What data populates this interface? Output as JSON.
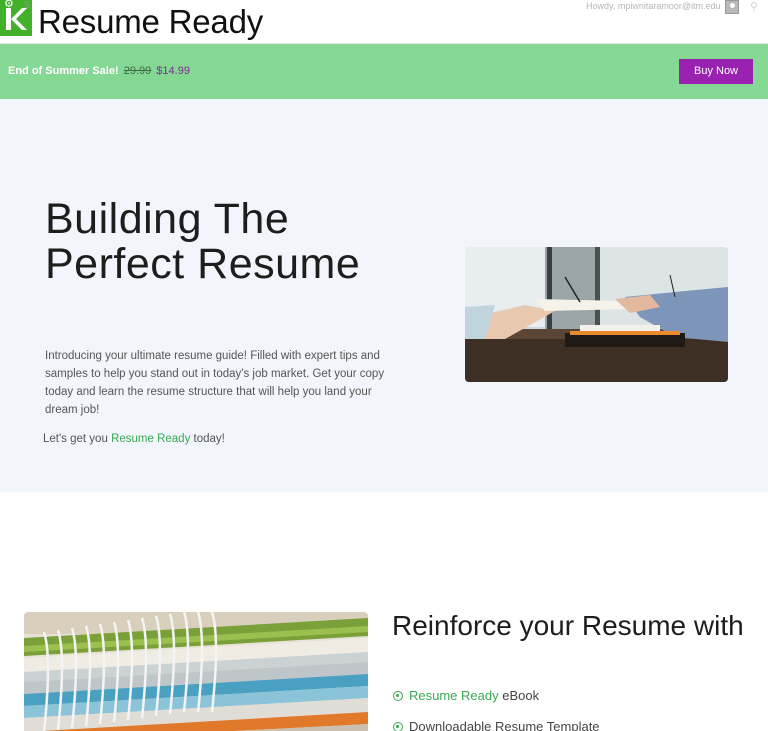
{
  "header": {
    "brand": "Resume Ready",
    "howdy": "Howdy, mpiwnitaramoor@itm.edu",
    "logo_icon": "k-logo-icon",
    "avatar_icon": "user-avatar-icon",
    "search_icon": "search-icon"
  },
  "promo": {
    "label": "End of Summer Sale!",
    "old_price": "29.99",
    "new_price": "$14.99",
    "button_label": "Buy Now",
    "bar_color": "#85d794",
    "button_color": "#9a22b0"
  },
  "hero": {
    "title": "Building The Perfect Resume",
    "description": "Introducing your ultimate resume guide! Filled with expert tips and samples to help you stand out in today's job market. Get your copy today and learn the resume structure that will help you land your dream job!",
    "cta_prefix": "Let's get you",
    "cta_link": "Resume Ready",
    "cta_suffix": "today!",
    "image_icon": "handshake-photo"
  },
  "section2": {
    "title": "Reinforce your Resume with",
    "list": [
      {
        "highlight": "Resume Ready",
        "text": " eBook"
      },
      {
        "highlight": "",
        "text": "Downloadable Resume Template"
      }
    ],
    "image_icon": "spiral-notebooks-photo"
  },
  "colors": {
    "accent_green": "#3aa853",
    "hero_bg": "#f2f5fb"
  }
}
